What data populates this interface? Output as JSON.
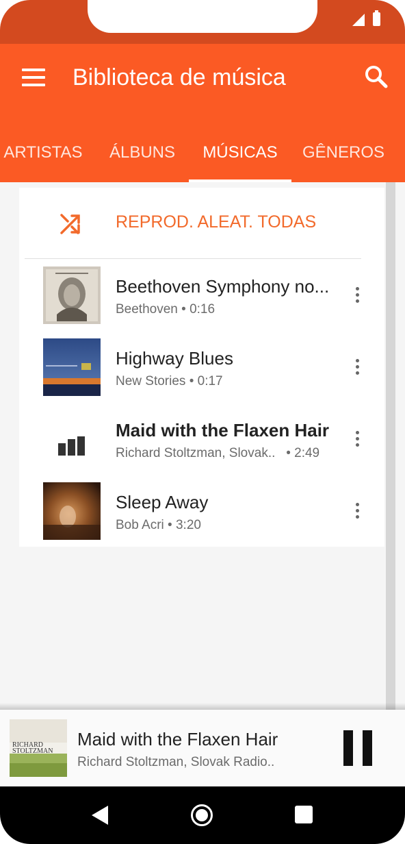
{
  "app": {
    "title": "Biblioteca de música"
  },
  "tabs": [
    {
      "label": "ARTISTAS",
      "active": false
    },
    {
      "label": "ÁLBUNS",
      "active": false
    },
    {
      "label": "MÚSICAS",
      "active": true
    },
    {
      "label": "GÊNEROS",
      "active": false
    }
  ],
  "shuffle": {
    "label": "REPROD. ALEAT. TODAS"
  },
  "songs": [
    {
      "title": "Beethoven Symphony no...",
      "subtitle": "Beethoven • 0:16",
      "art": "album-art-beethoven",
      "playing": false
    },
    {
      "title": "Highway Blues",
      "subtitle": "New Stories • 0:17",
      "art": "album-art-new-stories",
      "playing": false
    },
    {
      "title": "Maid with the Flaxen Hair",
      "subtitle": "Richard Stoltzman, Slovak..   • 2:49",
      "art": "now-playing-bars-icon",
      "playing": true
    },
    {
      "title": "Sleep Away",
      "subtitle": "Bob Acri • 3:20",
      "art": "album-art-bob-acri",
      "playing": false
    }
  ],
  "now_playing": {
    "title": "Maid with the Flaxen Hair",
    "subtitle": "Richard Stoltzman, Slovak Radio..",
    "art": "album-art-richard-stoltzman"
  },
  "colors": {
    "status_bar": "#d34a1f",
    "app_bar": "#fb5a24",
    "accent": "#f26a2b"
  },
  "icons": {
    "menu": "hamburger-menu-icon",
    "search": "search-icon",
    "shuffle": "shuffle-icon",
    "more": "more-vert-icon",
    "pause": "pause-icon",
    "back": "back-icon",
    "home": "home-icon",
    "recents": "recents-icon"
  }
}
